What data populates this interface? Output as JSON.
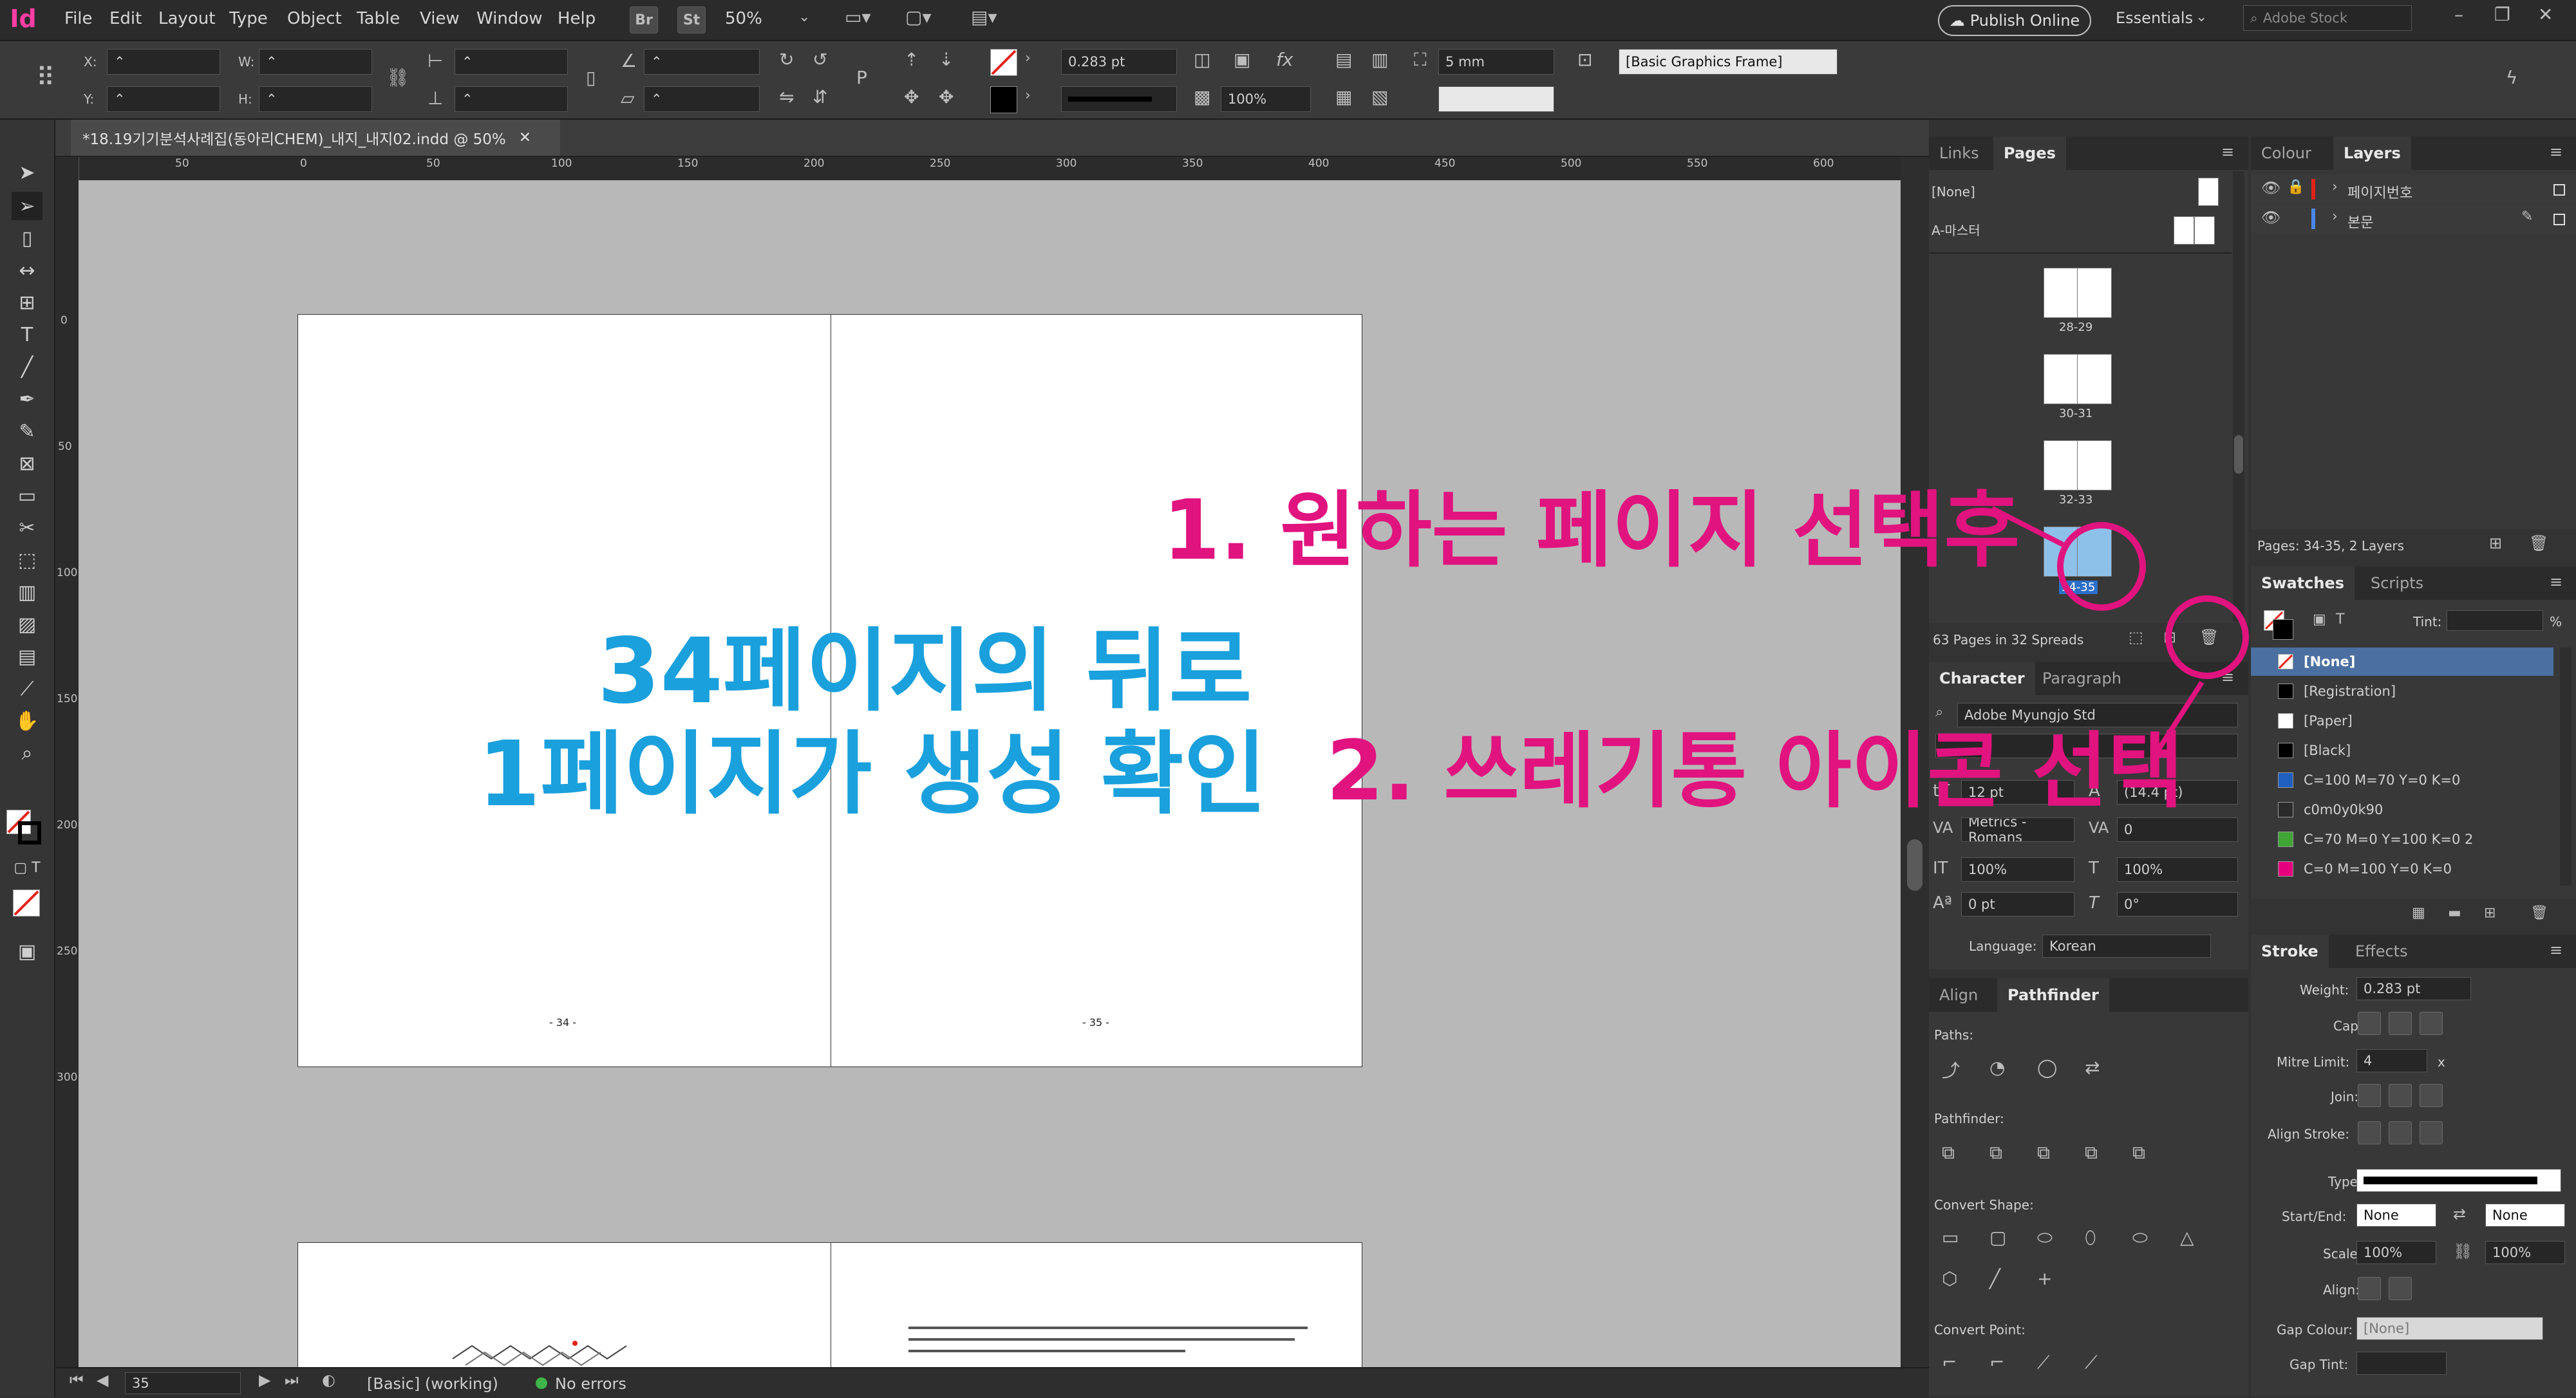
{
  "menubar": {
    "app_icon": "Id",
    "items": [
      "File",
      "Edit",
      "Layout",
      "Type",
      "Object",
      "Table",
      "View",
      "Window",
      "Help"
    ],
    "bridge": "Br",
    "stock": "St",
    "zoom": "50%",
    "publish": "Publish Online",
    "workspace": "Essentials",
    "search_placeholder": "Adobe Stock"
  },
  "control": {
    "x_label": "X:",
    "y_label": "Y:",
    "w_label": "W:",
    "h_label": "H:",
    "stroke_weight": "0.283 pt",
    "scale": "100%",
    "offset": "5 mm",
    "object_style": "[Basic Graphics Frame]"
  },
  "document": {
    "tab": "*18.19기기분석사례집(동아리CHEM)_내지_내지02.indd @ 50%",
    "ruler_h": [
      "50",
      "0",
      "50",
      "100",
      "150",
      "200",
      "250",
      "300",
      "350",
      "400",
      "450",
      "500",
      "550",
      "600"
    ],
    "ruler_v": [
      "0",
      "50",
      "100",
      "150",
      "200",
      "250",
      "300"
    ],
    "page_left_number": "- 34 -",
    "page_right_number": "- 35 -"
  },
  "status": {
    "page": "35",
    "master": "[Basic] (working)",
    "preflight": "No errors"
  },
  "pages_panel": {
    "tabs": [
      "Links",
      "Pages"
    ],
    "none_master": "[None]",
    "a_master": "A-마스터",
    "spreads": [
      "28-29",
      "30-31",
      "32-33",
      "34-35"
    ],
    "summary": "63 Pages in 32 Spreads"
  },
  "layers_panel": {
    "tabs": [
      "Colour",
      "Layers"
    ],
    "layers": [
      "페이지번호",
      "본문"
    ],
    "summary": "Pages: 34-35, 2 Layers"
  },
  "swatches_panel": {
    "tabs": [
      "Swatches",
      "Scripts"
    ],
    "tint_label": "Tint:",
    "tint_unit": "%",
    "items": [
      {
        "name": "[None]",
        "color": "#ffffff"
      },
      {
        "name": "[Registration]",
        "color": "#000000"
      },
      {
        "name": "[Paper]",
        "color": "#ffffff"
      },
      {
        "name": "[Black]",
        "color": "#000000"
      },
      {
        "name": "C=100 M=70 Y=0 K=0",
        "color": "#1f5fbf"
      },
      {
        "name": "c0m0y0k90",
        "color": "#2a2a2a"
      },
      {
        "name": "C=70 M=0 Y=100 K=0 2",
        "color": "#3fa535"
      },
      {
        "name": "C=0 M=100 Y=0 K=0",
        "color": "#e5007e"
      }
    ]
  },
  "character_panel": {
    "tabs": [
      "Character",
      "Paragraph"
    ],
    "font": "Adobe Myungjo Std",
    "size": "12 pt",
    "leading": "(14.4 pt)",
    "kerning": "Metrics - Romans",
    "tracking": "0",
    "v_scale": "100%",
    "h_scale": "100%",
    "baseline": "0 pt",
    "skew": "0°",
    "language_label": "Language:",
    "language": "Korean"
  },
  "pathfinder_panel": {
    "tabs": [
      "Align",
      "Pathfinder"
    ],
    "paths": "Paths:",
    "pathfinder": "Pathfinder:",
    "convert_shape": "Convert Shape:",
    "convert_point": "Convert Point:"
  },
  "stroke_panel": {
    "tabs": [
      "Stroke",
      "Effects"
    ],
    "weight_label": "Weight:",
    "weight": "0.283 pt",
    "cap_label": "Cap:",
    "mitre_label": "Mitre Limit:",
    "mitre": "4",
    "mitre_unit": "x",
    "join_label": "Join:",
    "align_label": "Align Stroke:",
    "type_label": "Type:",
    "startend_label": "Start/End:",
    "start": "None",
    "end": "None",
    "scale_label": "Scale:",
    "scale_start": "100%",
    "scale_end": "100%",
    "align2_label": "Align:",
    "gap_colour_label": "Gap Colour:",
    "gap_colour": "[None]",
    "gap_tint_label": "Gap Tint:"
  },
  "annotations": {
    "step1": "1. 원하는 페이지 선택후",
    "step2": "2. 쓰레기통 아이콘 선택",
    "result_line1": "34페이지의 뒤로",
    "result_line2": "1페이지가 생성 확인",
    "pink": "#e0137f",
    "blue": "#1aa0dc"
  }
}
